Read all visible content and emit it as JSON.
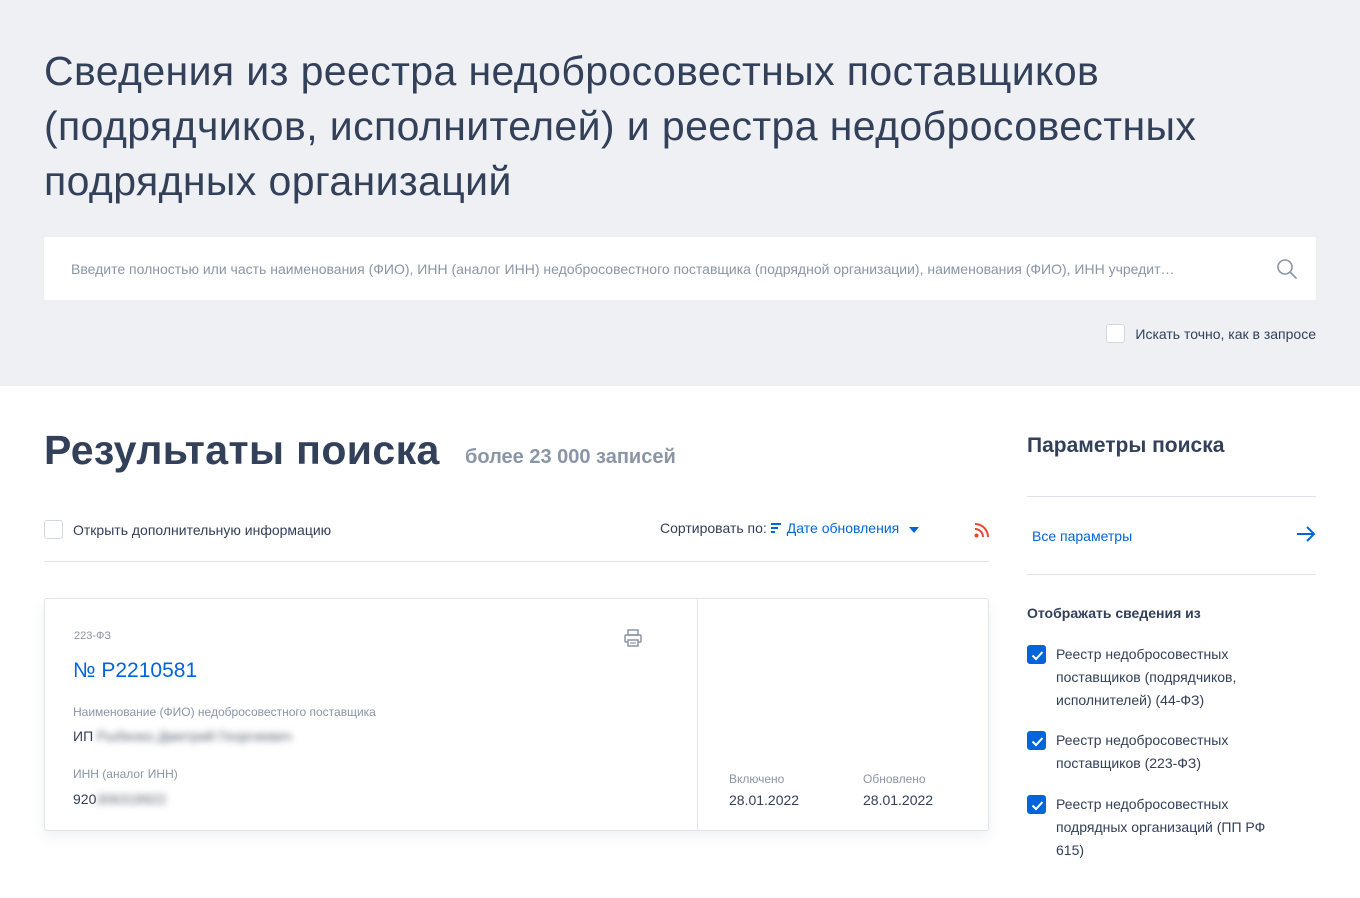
{
  "header": {
    "title": "Сведения из реестра недобросовестных поставщиков (подрядчиков, исполнителей) и реестра недобросовестных подрядных организаций",
    "search_placeholder": "Введите полностью или часть наименования (ФИО), ИНН (аналог ИНН) недобросовестного поставщика (подрядной организации), наименования (ФИО), ИНН учредит…",
    "exact_search_label": "Искать точно, как в запросе"
  },
  "results": {
    "title": "Результаты поиска",
    "count": "более 23 000 записей",
    "extra_info_label": "Открыть дополнительную информацию",
    "sort_label": "Сортировать по:",
    "sort_value": "Дате обновления"
  },
  "card": {
    "law": "223-ФЗ",
    "number": "№ Р2210581",
    "name_label": "Наименование (ФИО) недобросовестного поставщика",
    "name_prefix": "ИП",
    "name_hidden": "Рыбенко Дмитрий Георгиевич",
    "inn_label": "ИНН (аналог ИНН)",
    "inn_prefix": "920",
    "inn_hidden": "306318922",
    "included_label": "Включено",
    "included_date": "28.01.2022",
    "updated_label": "Обновлено",
    "updated_date": "28.01.2022"
  },
  "params": {
    "title": "Параметры поиска",
    "all_params": "Все параметры",
    "show_from": "Отображать сведения из",
    "options": [
      {
        "label": "Реестр недобросовестных поставщиков (подрядчиков, исполнителей) (44-ФЗ)",
        "checked": true
      },
      {
        "label": "Реестр недобросовестных поставщиков (223-ФЗ)",
        "checked": true
      },
      {
        "label": "Реестр недобросовестных подрядных организаций (ПП РФ 615)",
        "checked": true
      }
    ]
  },
  "colors": {
    "accent": "#0065dd",
    "text": "#334059",
    "muted": "#8a95a6",
    "header_bg": "#eef0f3",
    "rss": "#e8472b"
  }
}
